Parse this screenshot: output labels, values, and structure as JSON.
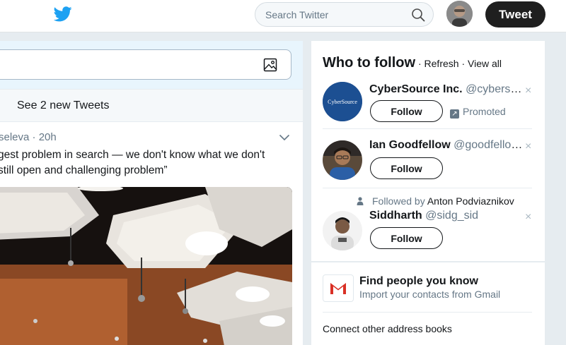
{
  "topbar": {
    "search_placeholder": "Search Twitter",
    "tweet_button": "Tweet",
    "bird_icon": "twitter-bird-icon",
    "accent_color": "#1da1f2"
  },
  "stream": {
    "new_tweets_label": "See 2 new Tweets",
    "tweet": {
      "meta": "seleva · 20h",
      "text_lines": [
        "gest problem in search — we don't know what we don't",
        "still open and challenging problem”"
      ]
    }
  },
  "who_to_follow": {
    "title": "Who to follow",
    "sep1": " · ",
    "refresh": "Refresh",
    "sep2": " · ",
    "view_all": "View all",
    "items": [
      {
        "name": "CyberSource Inc.",
        "handle": "@cybersource",
        "follow_label": "Follow",
        "promoted": "Promoted",
        "avatar_text": "CyberSource"
      },
      {
        "name": "Ian Goodfellow",
        "handle": "@goodfellow_ian",
        "follow_label": "Follow"
      },
      {
        "social_prefix": "Followed by",
        "social_name": "Anton Podviaznikov",
        "name": "Siddharth",
        "handle": "@sidg_sid",
        "follow_label": "Follow"
      }
    ],
    "close_glyph": "×"
  },
  "find_people": {
    "title": "Find people you know",
    "subtitle": "Import your contacts from Gmail",
    "connect": "Connect other address books"
  }
}
